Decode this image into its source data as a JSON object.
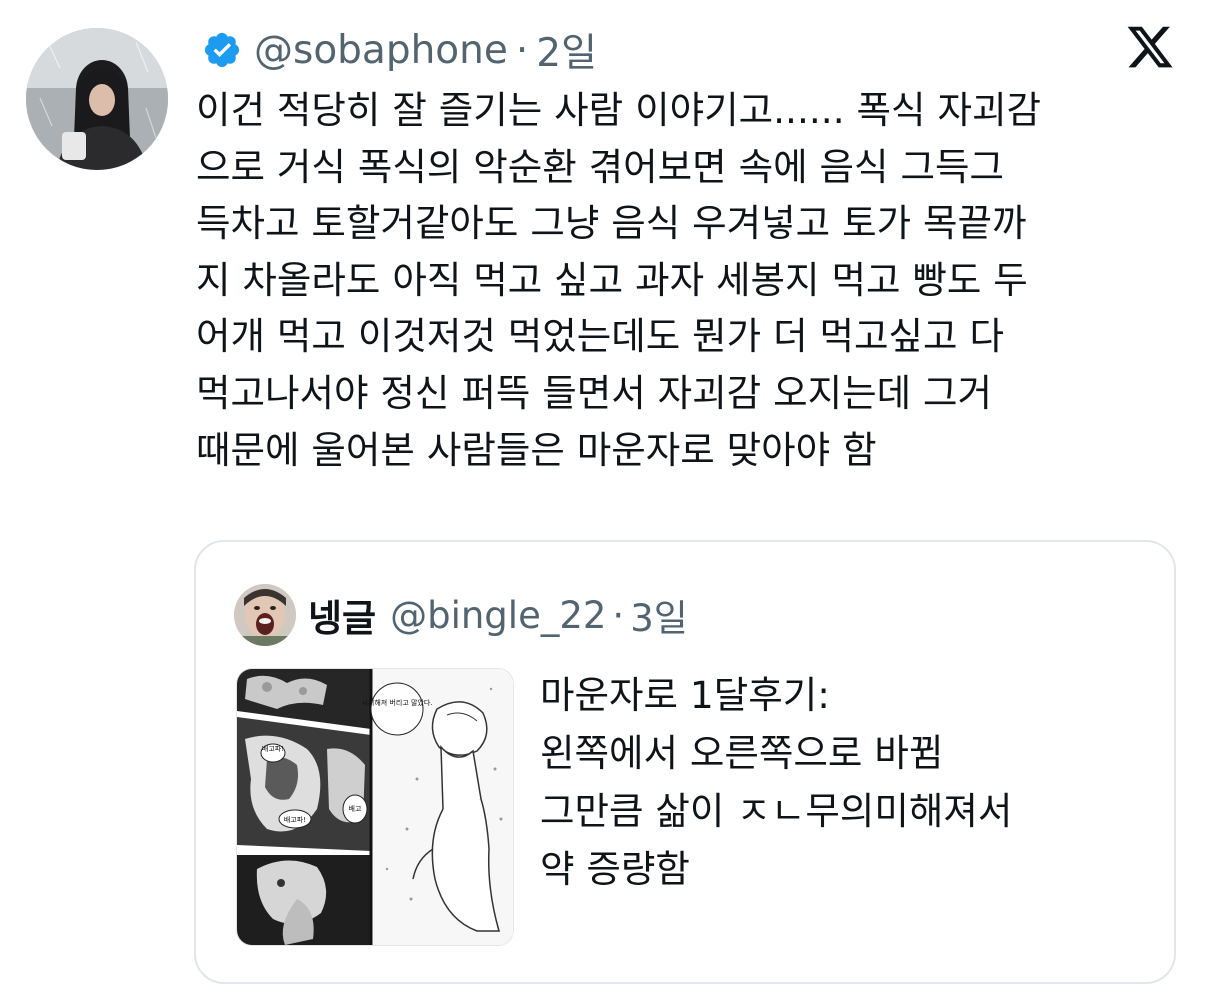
{
  "tweet": {
    "handle": "@sobaphone",
    "separator": "·",
    "time": "2일",
    "verified": true,
    "lines": [
      "이건 적당히 잘 즐기는 사람 이야기고...... 폭식 자괴감",
      "으로 거식 폭식의 악순환 겪어보면 속에 음식 그득그",
      "득차고 토할거같아도 그냥 음식 우겨넣고 토가 목끝까",
      "지 차올라도 아직 먹고 싶고 과자 세봉지 먹고 빵도 두",
      "어개 먹고 이것저것 먹었는데도 뭔가 더 먹고싶고 다",
      "먹고나서야 정신 퍼뜩 들면서 자괴감 오지는데 그거",
      "때문에 울어본 사람들은 마운자로 맞아야 함"
    ]
  },
  "quoted": {
    "name": "넹글",
    "handle": "@bingle_22",
    "separator": "·",
    "time": "3일",
    "lines": [
      "마운자로 1달후기:",
      "왼쪽에서 오른쪽으로 바뀜",
      "그만큼 삶이 ㅈㄴ무의미해져서",
      "약 증량함"
    ],
    "media": {
      "bubble_text_1": "시시해져 버리고 말았다.",
      "bubble_text_2": "배고파!",
      "bubble_text_3": "배고파!",
      "bubble_text_4": "배고"
    }
  },
  "icons": {
    "verified": "verified-badge-icon",
    "brand": "x-logo-icon"
  },
  "colors": {
    "text": "#0f1419",
    "secondary": "#536471",
    "verified": "#1d9bf0",
    "border": "#e1e6ea"
  }
}
